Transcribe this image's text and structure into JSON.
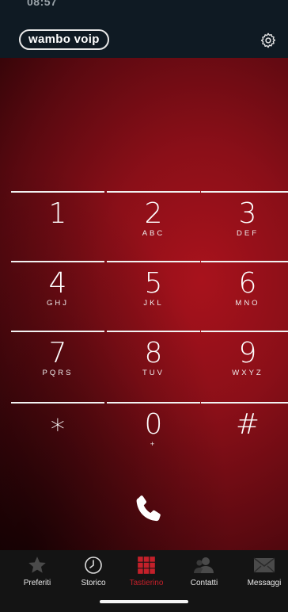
{
  "status_bar": {
    "time": "08:57",
    "icons": ""
  },
  "header": {
    "brand": "wambo voip",
    "settings_icon": "gear-icon"
  },
  "keypad": [
    {
      "digit": "1",
      "letters": ""
    },
    {
      "digit": "2",
      "letters": "ABC"
    },
    {
      "digit": "3",
      "letters": "DEF"
    },
    {
      "digit": "4",
      "letters": "GHJ"
    },
    {
      "digit": "5",
      "letters": "JKL"
    },
    {
      "digit": "6",
      "letters": "MNO"
    },
    {
      "digit": "7",
      "letters": "PQRS"
    },
    {
      "digit": "8",
      "letters": "TUV"
    },
    {
      "digit": "9",
      "letters": "WXYZ"
    },
    {
      "digit": "∗",
      "letters": ""
    },
    {
      "digit": "0",
      "letters": "+"
    },
    {
      "digit": "#",
      "letters": ""
    }
  ],
  "call": {
    "icon": "phone-icon"
  },
  "tabs": [
    {
      "label": "Preferiti",
      "icon": "star-icon"
    },
    {
      "label": "Storico",
      "icon": "clock-icon"
    },
    {
      "label": "Tastierino",
      "icon": "keypad-icon",
      "active": true
    },
    {
      "label": "Contatti",
      "icon": "contacts-icon"
    },
    {
      "label": "Messaggi",
      "icon": "envelope-icon"
    }
  ],
  "colors": {
    "accent": "#c4202a",
    "header_bg": "#0f1a23",
    "keypad_bg": "#8a0f18",
    "tabbar_bg": "#141414"
  }
}
